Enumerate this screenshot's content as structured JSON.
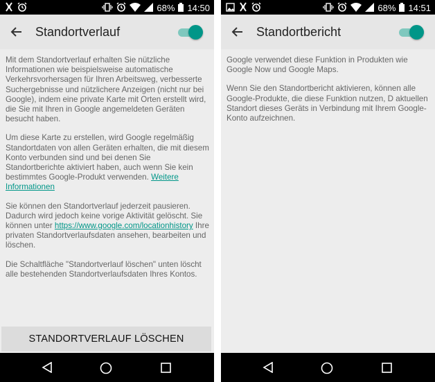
{
  "screens": [
    {
      "status_bar": {
        "battery": "68%",
        "time": "14:50"
      },
      "app_bar": {
        "title": "Standortverlauf",
        "toggle_on": true
      },
      "paragraphs": [
        "Mit dem Standortverlauf erhalten Sie nützliche Informationen wie beispielsweise automatische Verkehrsvorhersagen für Ihren Arbeitsweg, verbesserte Suchergebnisse und nützlichere Anzeigen (nicht nur bei Google), indem eine private Karte mit Orten erstellt wird, die Sie mit Ihren in Google angemeldeten Geräten besucht haben.",
        "Um diese Karte zu erstellen, wird Google regelmäßig Standortdaten von allen Geräten erhalten, die mit diesem Konto verbunden sind und bei denen Sie Standortberichte aktiviert haben, auch wenn Sie kein bestimmtes Google-Produkt verwenden.",
        "Sie können den Standortverlauf jederzeit pausieren. Dadurch wird jedoch keine vorige Aktivität gelöscht. Sie können unter",
        "Ihre privaten Standortverlaufsdaten ansehen, bearbeiten und löschen.",
        "Die Schaltfläche \"Standortverlauf löschen\" unten löscht alle bestehenden Standortverlaufsdaten Ihres Kontos."
      ],
      "link_more": "Weitere Informationen",
      "link_history": "https://www.google.com/locationhistory",
      "button_label": "STANDORTVERLAUF LÖSCHEN"
    },
    {
      "status_bar": {
        "battery": "68%",
        "time": "14:51"
      },
      "app_bar": {
        "title": "Standortbericht",
        "toggle_on": true
      },
      "paragraphs": [
        "Google verwendet diese Funktion in Produkten wie Google Now und Google Maps.",
        "Wenn Sie den Standortbericht aktivieren, können alle Google-Produkte, die diese Funktion nutzen, D aktuellen Standort dieses Geräts in Verbindung mit Ihrem Google-Konto aufzeichnen."
      ]
    }
  ],
  "colors": {
    "accent": "#009688",
    "toggle_track": "#7fc8be",
    "screen_bg": "#ededed",
    "app_bar": "#e6e6e6",
    "button_bg": "#dcdcdc"
  },
  "icons": [
    "tools-icon",
    "alarm-icon",
    "vibrate-icon",
    "wifi-icon",
    "signal-icon",
    "battery-icon",
    "back-arrow-icon",
    "nav-back-icon",
    "nav-home-icon",
    "nav-recent-icon",
    "image-icon"
  ]
}
